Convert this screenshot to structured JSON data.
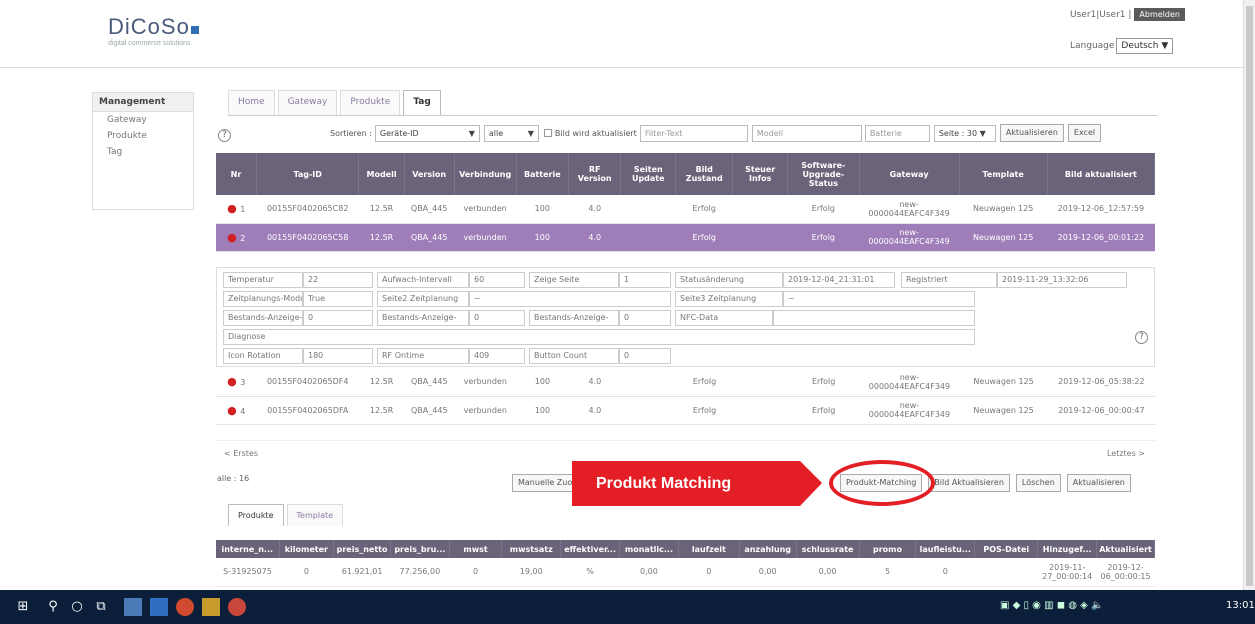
{
  "header": {
    "logo": "DiCoSo",
    "tagline": "digital commerce solutions",
    "user": "User1|User1 |",
    "logout": "Abmelden",
    "lang_label": "Language",
    "lang_value": "Deutsch"
  },
  "sidebar": {
    "title": "Management",
    "items": [
      "Gateway",
      "Produkte",
      "Tag"
    ]
  },
  "tabs": [
    "Home",
    "Gateway",
    "Produkte",
    "Tag"
  ],
  "toolbar": {
    "sort_label": "Sortieren :",
    "sort_value": "Geräte-ID",
    "filter_value": "alle",
    "checkbox_label": "Bild wird aktualisiert",
    "filter_ph": "Filter-Text",
    "model_ph": "Modell",
    "battery_ph": "Batterie",
    "page_label": "Seite :",
    "page_value": "30",
    "refresh": "Aktualisieren",
    "excel": "Excel"
  },
  "columns": [
    "Nr",
    "Tag-ID",
    "Modell",
    "Version",
    "Verbindung",
    "Batterie",
    "RF Version",
    "Seiten Update",
    "Bild Zustand",
    "Steuer Infos",
    "Software-Upgrade-Status",
    "Gateway",
    "Template",
    "Bild aktualisiert"
  ],
  "rows": [
    {
      "nr": "1",
      "id": "00155F0402065C82",
      "model": "12.5R",
      "version": "QBA_445",
      "conn": "verbunden",
      "batt": "100",
      "rf": "4.0",
      "img": "Erfolg",
      "sw": "Erfolg",
      "gw": "new-0000044EAFC4F349",
      "tpl": "Neuwagen 125",
      "upd": "2019-12-06_12:57:59",
      "sel": false
    },
    {
      "nr": "2",
      "id": "00155F0402065C58",
      "model": "12.5R",
      "version": "QBA_445",
      "conn": "verbunden",
      "batt": "100",
      "rf": "4.0",
      "img": "Erfolg",
      "sw": "Erfolg",
      "gw": "new-0000044EAFC4F349",
      "tpl": "Neuwagen 125",
      "upd": "2019-12-06_00:01:22",
      "sel": true
    },
    {
      "nr": "3",
      "id": "00155F0402065DF4",
      "model": "12.5R",
      "version": "QBA_445",
      "conn": "verbunden",
      "batt": "100",
      "rf": "4.0",
      "img": "Erfolg",
      "sw": "Erfolg",
      "gw": "new-0000044EAFC4F349",
      "tpl": "Neuwagen 125",
      "upd": "2019-12-06_05:38:22",
      "sel": false
    },
    {
      "nr": "4",
      "id": "00155F0402065DFA",
      "model": "12.5R",
      "version": "QBA_445",
      "conn": "verbunden",
      "batt": "100",
      "rf": "4.0",
      "img": "Erfolg",
      "sw": "Erfolg",
      "gw": "new-0000044EAFC4F349",
      "tpl": "Neuwagen 125",
      "upd": "2019-12-06_00:00:47",
      "sel": false
    }
  ],
  "detail": {
    "temp_l": "Temperatur",
    "temp_v": "22",
    "wake_l": "Aufwach-Intervall",
    "wake_v": "60",
    "page_l": "Zeige Seite",
    "page_v": "1",
    "status_l": "Statusänderung",
    "status_v": "2019-12-04_21:31:01",
    "reg_l": "Registriert",
    "reg_v": "2019-11-29_13:32:06",
    "plan_l": "Zeitplanungs-Modus",
    "plan_v": "True",
    "plan2_l": "Seite2 Zeitplanung",
    "plan2_v": "~",
    "plan3_l": "Seite3 Zeitplanung",
    "plan3_v": "~",
    "stock1_l": "Bestands-Anzeige-",
    "stock1_v": "0",
    "stock2_l": "Bestands-Anzeige-",
    "stock2_v": "0",
    "stock3_l": "Bestands-Anzeige-",
    "stock3_v": "0",
    "nfc_l": "NFC-Data",
    "diag_l": "Diagnose",
    "rot_l": "Icon Rotation",
    "rot_v": "180",
    "rf_l": "RF Ontime",
    "rf_v": "409",
    "btn_l": "Button Count",
    "btn_v": "0"
  },
  "pager": {
    "first": "< Erstes",
    "last": "Letztes >",
    "count": "alle : 16"
  },
  "actions": {
    "manual": "Manuelle Zuordnung",
    "match": "Produkt-Matching",
    "img_upd": "Bild Aktualisieren",
    "delete": "Löschen",
    "refresh": "Aktualisieren"
  },
  "annotation": "Produkt Matching",
  "bottom_tabs": [
    "Produkte",
    "Template"
  ],
  "bottom_cols": [
    "interne_n...",
    "kilometer",
    "preis_netto",
    "preis_bru...",
    "mwst",
    "mwstsatz",
    "effektiver...",
    "monatlic...",
    "laufzeit",
    "anzahlung",
    "schlussrate",
    "promo",
    "laufleistu...",
    "POS-Datei",
    "Hinzugef...",
    "Aktualisiert"
  ],
  "bottom_row": [
    "S-31925075",
    "0",
    "61.921,01",
    "77.256,00",
    "0",
    "19,00",
    "%",
    "0,00",
    "0",
    "0,00",
    "0,00",
    "5",
    "0",
    "",
    "2019-11-27_00:00:14",
    "2019-12-06_00:00:15"
  ],
  "taskbar": {
    "time": "13:01"
  }
}
